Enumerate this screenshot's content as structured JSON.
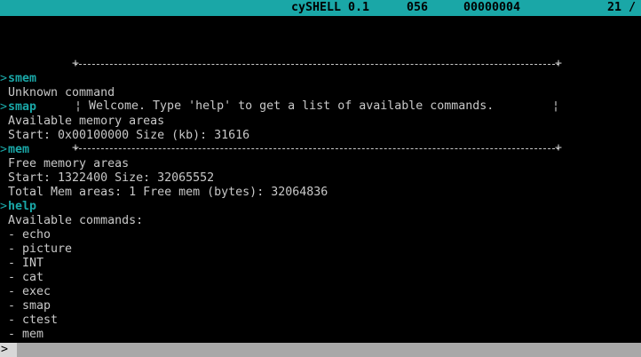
{
  "topbar": {
    "title": "cySHELL 0.1",
    "count": "056",
    "address": "00000004",
    "right": "21 /"
  },
  "banner": {
    "left_bar": "¦",
    "message": "Welcome. Type 'help' to get a list of available commands.",
    "right_bar": "¦"
  },
  "log": [
    {
      "type": "cmd",
      "text": "smem"
    },
    {
      "type": "out",
      "text": "Unknown command"
    },
    {
      "type": "cmd",
      "text": "smap"
    },
    {
      "type": "out",
      "text": "Available memory areas"
    },
    {
      "type": "out",
      "text": "Start: 0x00100000 Size (kb): 31616"
    },
    {
      "type": "cmd",
      "text": "mem"
    },
    {
      "type": "out",
      "text": "Free memory areas"
    },
    {
      "type": "out",
      "text": "Start: 1322400 Size: 32065552"
    },
    {
      "type": "out",
      "text": "Total Mem areas: 1 Free mem (bytes): 32064836"
    },
    {
      "type": "cmd",
      "text": "help"
    },
    {
      "type": "out",
      "text": "Available commands:"
    },
    {
      "type": "out",
      "text": "- echo"
    },
    {
      "type": "out",
      "text": "- picture"
    },
    {
      "type": "out",
      "text": "- INT"
    },
    {
      "type": "out",
      "text": "- cat"
    },
    {
      "type": "out",
      "text": "- exec"
    },
    {
      "type": "out",
      "text": "- smap"
    },
    {
      "type": "out",
      "text": "- ctest"
    },
    {
      "type": "out",
      "text": "- mem"
    }
  ],
  "prompt_symbol": ">",
  "input": {
    "value": ""
  },
  "colors": {
    "accent": "#1aa7a7",
    "text": "#c8c8c8",
    "background": "#000000",
    "input_bar": "#a8a8a8"
  }
}
